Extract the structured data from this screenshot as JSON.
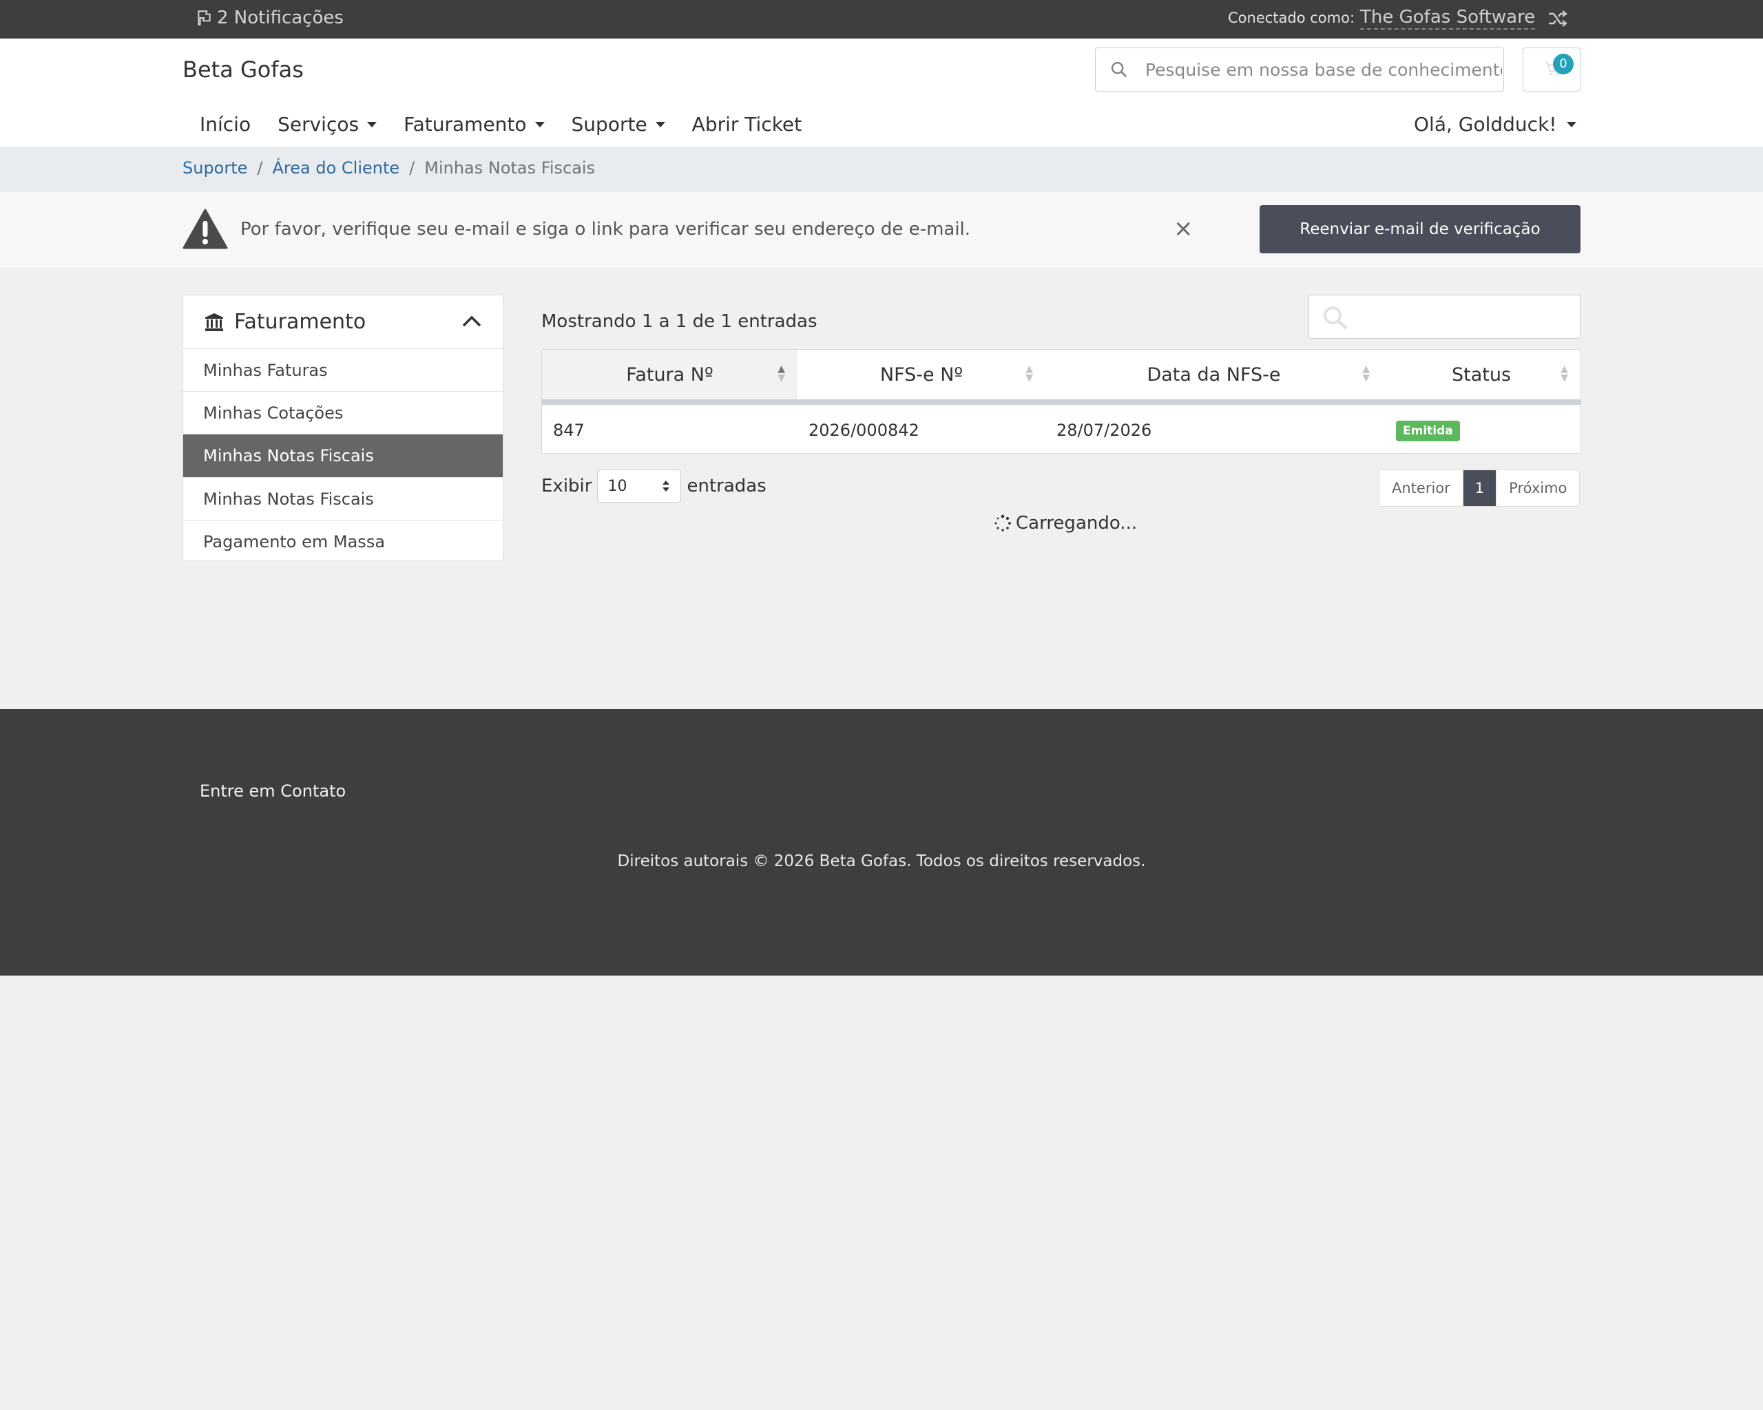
{
  "topbar": {
    "notifications": "2 Notificações",
    "logged_as_label": "Conectado como:",
    "account_name": "The Gofas Software"
  },
  "header": {
    "brand": "Beta Gofas",
    "search_placeholder": "Pesquise em nossa base de conhecimento",
    "cart_count": "0",
    "nav": {
      "home": "Início",
      "services": "Serviços",
      "billing": "Faturamento",
      "support": "Suporte",
      "open_ticket": "Abrir Ticket"
    },
    "user_menu": "Olá, Goldduck!"
  },
  "breadcrumb": {
    "items": [
      "Suporte",
      "Área do Cliente"
    ],
    "current": "Minhas Notas Fiscais"
  },
  "alert": {
    "message": "Por favor, verifique seu e-mail e siga o link para verificar seu endereço de e-mail.",
    "close": "×",
    "resend_button": "Reenviar e-mail de verificação"
  },
  "sidebar": {
    "title": "Faturamento",
    "links": [
      "Minhas Faturas",
      "Minhas Cotações",
      "Minhas Notas Fiscais",
      "Minhas Notas Fiscais",
      "Pagamento em Massa"
    ],
    "active_index": 2
  },
  "table": {
    "info": "Mostrando 1 a 1 de 1 entradas",
    "columns": [
      "Fatura Nº",
      "NFS-e Nº",
      "Data da NFS-e",
      "Status"
    ],
    "rows": [
      {
        "invoice": "847",
        "nfse": "2026/000842",
        "date": "28/07/2026",
        "status": "Emitida"
      }
    ],
    "length_label_before": "Exibir",
    "length_value": "10",
    "length_label_after": "entradas",
    "pagination": {
      "prev": "Anterior",
      "current": "1",
      "next": "Próximo"
    },
    "loading": "Carregando..."
  },
  "footer": {
    "contact": "Entre em Contato",
    "copyright": "Direitos autorais © 2026 Beta Gofas. Todos os direitos reservados."
  },
  "colors": {
    "topbar": "#3e3e3e",
    "primary_dark": "#4a4e5a",
    "status_green": "#5cb85c",
    "cart_badge": "#23a2b8",
    "link": "#2f6aa0"
  },
  "icons": {
    "notifications": "flag-icon",
    "switch_account": "shuffle-icon",
    "search": "search-icon",
    "cart": "cart-icon",
    "alert": "warning-icon",
    "sidebar": "bank-icon",
    "collapse": "chevron-up-icon",
    "loading": "spinner-icon"
  }
}
